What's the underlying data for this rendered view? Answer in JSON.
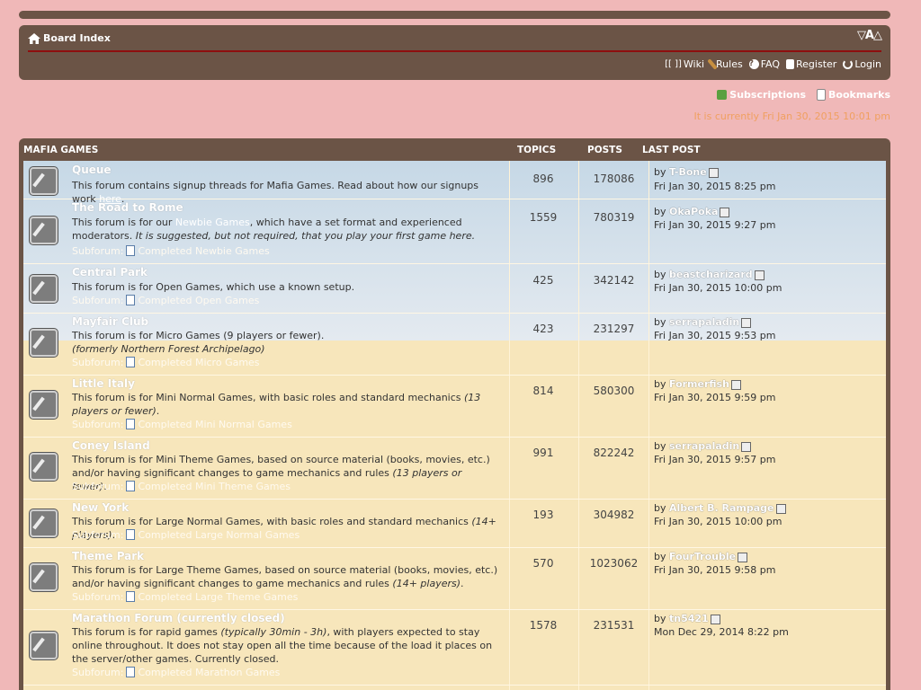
{
  "header": {
    "breadcrumb": "Board Index",
    "font_size_control": "▽A△",
    "links": [
      {
        "icon": "wiki-icon",
        "label": "Wiki",
        "glyph": "[[ ]]"
      },
      {
        "icon": "rules-icon",
        "label": "Rules"
      },
      {
        "icon": "faq-icon",
        "label": "FAQ"
      },
      {
        "icon": "register-icon",
        "label": "Register"
      },
      {
        "icon": "power-icon",
        "label": "Login"
      }
    ]
  },
  "subscriptions_label": "Subscriptions",
  "bookmarks_label": "Bookmarks",
  "last_visit": "It is currently Fri Jan 30, 2015 10:01 pm",
  "forum_table": {
    "category": "MAFIA GAMES",
    "col_topics": "TOPICS",
    "col_posts": "POSTS",
    "col_last_post": "LAST POST",
    "by_prefix": "by",
    "rows": [
      {
        "title": "Queue",
        "desc_a": "This forum contains signup threads for Mafia Games. Read about how our signups work ",
        "desc_link": "here",
        "desc_b": ".",
        "subforum": "",
        "topics": "896",
        "posts": "178086",
        "author": "T-Bone",
        "time": "Fri Jan 30, 2015 8:25 pm"
      },
      {
        "title": "The Road to Rome",
        "desc_a": "This forum is for our ",
        "desc_link": "Newbie Games",
        "desc_b": ", which have a set format and experienced moderators. ",
        "desc_i": "It is suggested, but not required, that you play your first game here.",
        "subforum_label": "Subforum:",
        "subforum": "Completed Newbie Games",
        "topics": "1559",
        "posts": "780319",
        "author": "OkaPoka",
        "time": "Fri Jan 30, 2015 9:27 pm"
      },
      {
        "title": "Central Park",
        "desc_a": "This forum is for Open Games, which use a known setup.",
        "subforum_label": "Subforum:",
        "subforum": "Completed Open Games",
        "topics": "425",
        "posts": "342142",
        "author": "beastcharizard",
        "time": "Fri Jan 30, 2015 10:00 pm"
      },
      {
        "title": "Mayfair Club",
        "desc_a": "This forum is for Micro Games (9 players or fewer).",
        "desc_i": "(formerly Northern Forest Archipelago)",
        "subforum_label": "Subforum:",
        "subforum": "Completed Micro Games",
        "topics": "423",
        "posts": "231297",
        "author": "serrapaladin",
        "time": "Fri Jan 30, 2015 9:53 pm"
      },
      {
        "title": "Little Italy",
        "desc_a": "This forum is for Mini Normal Games, with basic roles and standard mechanics ",
        "desc_i": "(13 players or fewer)",
        "desc_b": ".",
        "subforum_label": "Subforum:",
        "subforum": "Completed Mini Normal Games",
        "topics": "814",
        "posts": "580300",
        "author": "Formerfish",
        "time": "Fri Jan 30, 2015 9:59 pm"
      },
      {
        "title": "Coney Island",
        "desc_a": "This forum is for Mini Theme Games, based on source material (books, movies, etc.) and/or having significant changes to game mechanics and rules ",
        "desc_i": "(13 players or fewer)",
        "desc_b": ".",
        "subforum_label": "Subforum:",
        "subforum": "Completed Mini Theme Games",
        "topics": "991",
        "posts": "822242",
        "author": "serrapaladin",
        "time": "Fri Jan 30, 2015 9:57 pm"
      },
      {
        "title": "New York",
        "desc_a": "This forum is for Large Normal Games, with basic roles and standard mechanics ",
        "desc_i": "(14+ players)",
        "desc_b": ".",
        "subforum_label": "Subforum:",
        "subforum": "Completed Large Normal Games",
        "topics": "193",
        "posts": "304982",
        "author": "Albert B. Rampage",
        "time": "Fri Jan 30, 2015 10:00 pm"
      },
      {
        "title": "Theme Park",
        "desc_a": "This forum is for Large Theme Games, based on source material (books, movies, etc.) and/or having significant changes to game mechanics and rules ",
        "desc_i": "(14+ players)",
        "desc_b": ".",
        "subforum_label": "Subforum:",
        "subforum": "Completed Large Theme Games",
        "topics": "570",
        "posts": "1023062",
        "author": "FourTrouble",
        "time": "Fri Jan 30, 2015 9:58 pm"
      },
      {
        "title": "Marathon Forum (currently closed)",
        "desc_a": "This forum is for rapid games ",
        "desc_i": "(typically 30min - 3h)",
        "desc_b": ", with players expected to stay online throughout. It does not stay open all the time because of the load it places on the server/other games. Currently closed.",
        "subforum_label": "Subforum:",
        "subforum": "Completed Marathon Games",
        "topics": "1578",
        "posts": "231531",
        "author": "tn5421",
        "time": "Mon Dec 29, 2014 8:22 pm"
      }
    ]
  }
}
